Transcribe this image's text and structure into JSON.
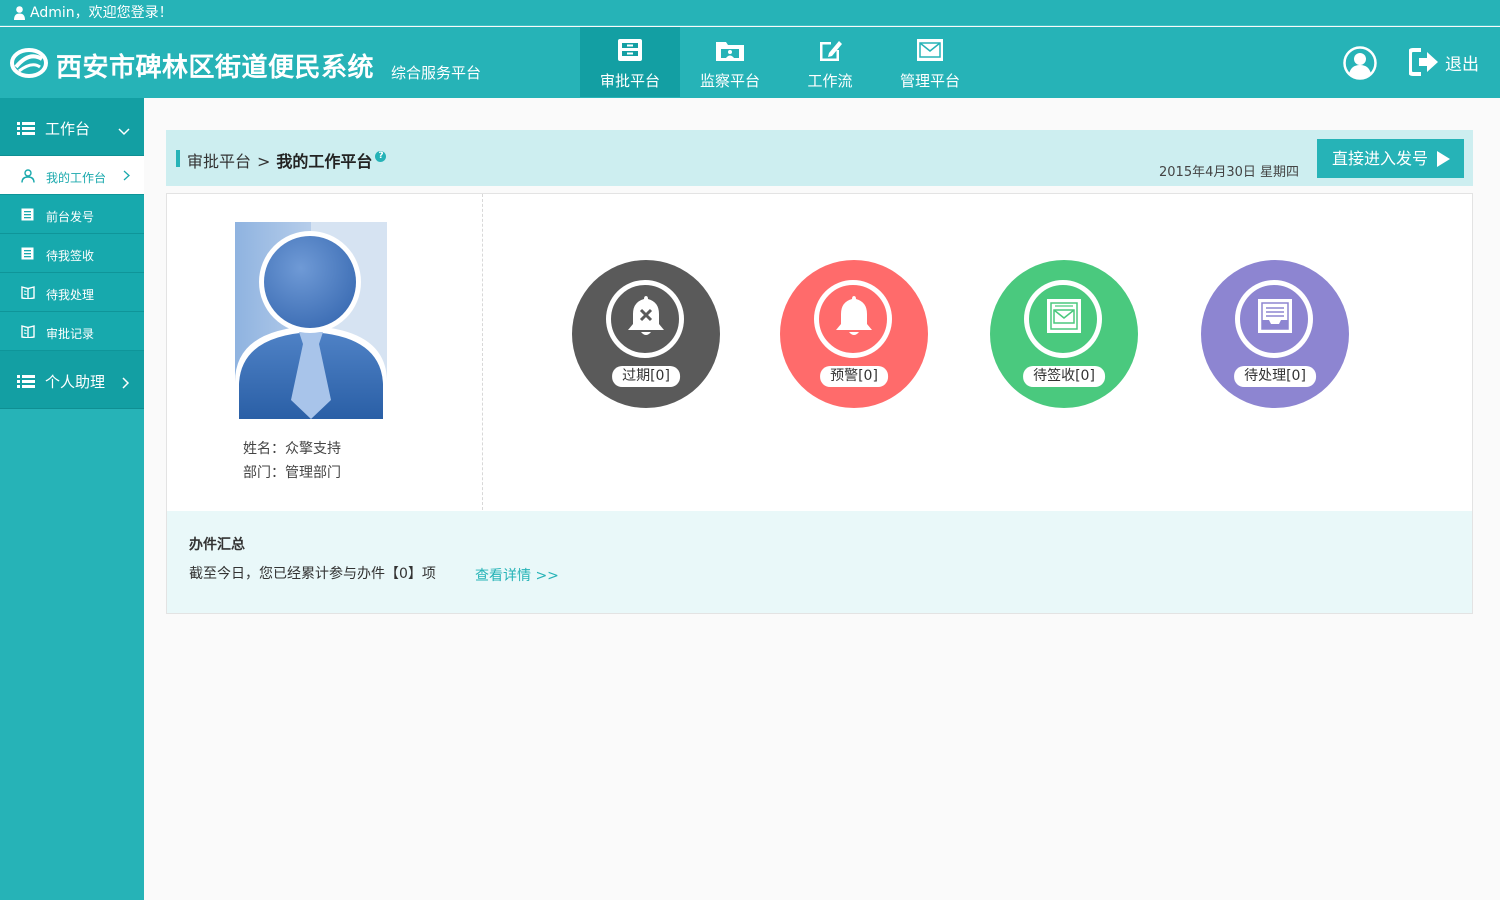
{
  "topbar": {
    "welcome": "Admin，欢迎您登录！"
  },
  "header": {
    "title": "西安市碑林区街道便民系统",
    "subtitle": "综合服务平台",
    "nav": [
      {
        "label": "审批平台",
        "icon": "cabinet-icon",
        "active": true
      },
      {
        "label": "监察平台",
        "icon": "folder-icon",
        "active": false
      },
      {
        "label": "工作流",
        "icon": "edit-icon",
        "active": false
      },
      {
        "label": "管理平台",
        "icon": "mail-icon",
        "active": false
      }
    ],
    "logout": "退出"
  },
  "sidebar": {
    "groups": [
      {
        "label": "工作台",
        "expanded": true
      },
      {
        "label": "个人助理",
        "expanded": false
      }
    ],
    "items": [
      {
        "label": "我的工作台",
        "active": true
      },
      {
        "label": "前台发号"
      },
      {
        "label": "待我签收"
      },
      {
        "label": "待我处理"
      },
      {
        "label": "审批记录"
      }
    ]
  },
  "breadcrumb": {
    "root": "审批平台",
    "separator": ">",
    "current": "我的工作平台",
    "help": "?"
  },
  "date": "2015年4月30日 星期四",
  "go_button": "直接进入发号",
  "profile": {
    "name": "姓名：众擎支持",
    "dept": "部门：管理部门"
  },
  "stats": [
    {
      "label": "过期[0]",
      "color": "#5a5a5a",
      "icon": "bell-x-icon"
    },
    {
      "label": "预警[0]",
      "color": "#ff6b6b",
      "icon": "bell-icon"
    },
    {
      "label": "待签收[0]",
      "color": "#4ac97e",
      "icon": "mail-icon"
    },
    {
      "label": "待处理[0]",
      "color": "#8d85d1",
      "icon": "inbox-icon"
    }
  ],
  "summary": {
    "title": "办件汇总",
    "text": "截至今日，您已经累计参与办件【0】项",
    "link": "查看详情 >>"
  },
  "colors": {
    "brand": "#26b3b7",
    "brand_dark": "#139fa3",
    "crumb_bg": "#cdeef0",
    "summary_bg": "#e9f8f9"
  }
}
